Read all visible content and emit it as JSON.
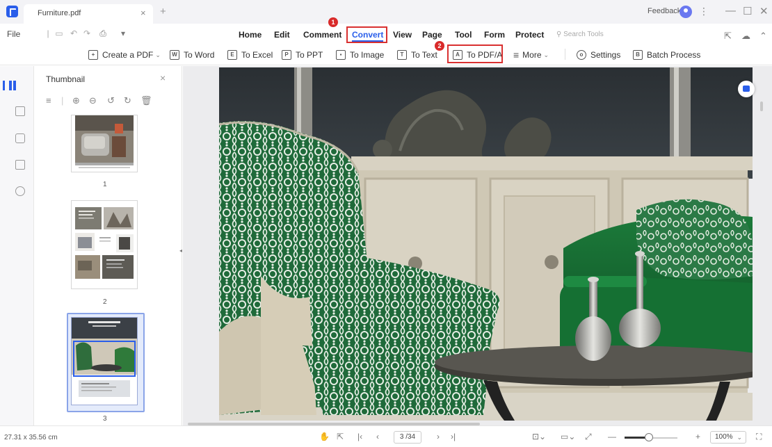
{
  "titlebar": {
    "tab_title": "Furniture.pdf",
    "tab_close": "×",
    "new_tab": "+",
    "feedback": "Feedback",
    "minimize": "—",
    "maximize": "☐",
    "close": "✕"
  },
  "menubar": {
    "file": "File",
    "items": [
      "Home",
      "Edit",
      "Comment",
      "Convert",
      "View",
      "Page",
      "Tool",
      "Form",
      "Protect"
    ],
    "search_placeholder": "Search Tools"
  },
  "ribbon": {
    "create_pdf": "Create a PDF",
    "to_word": "To Word",
    "to_excel": "To Excel",
    "to_ppt": "To PPT",
    "to_image": "To Image",
    "to_text": "To Text",
    "to_pdfa": "To PDF/A",
    "more": "More",
    "settings": "Settings",
    "batch_process": "Batch Process"
  },
  "annotations": {
    "badge_1": "1",
    "badge_2": "2",
    "highlight_color": "#d93030"
  },
  "thumbnail": {
    "title": "Thumbnail",
    "close": "×",
    "pages": [
      "1",
      "2",
      "3"
    ],
    "selected_page": 3
  },
  "statusbar": {
    "dimensions": "27.31 x 35.56 cm",
    "page_field": "3 /34",
    "zoom": "100%"
  },
  "colors": {
    "accent": "#2a5eea",
    "annotation_red": "#d93030"
  }
}
